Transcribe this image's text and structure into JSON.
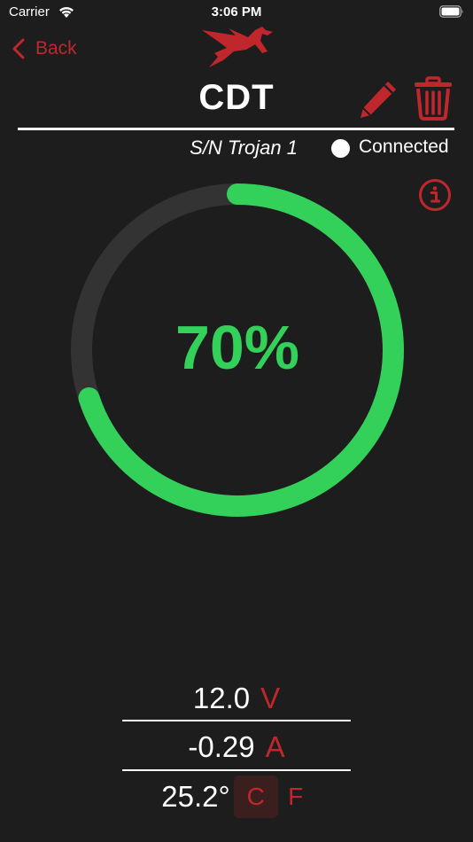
{
  "status_bar": {
    "carrier": "Carrier",
    "time": "3:06 PM"
  },
  "nav": {
    "back_label": "Back"
  },
  "device": {
    "name": "CDT",
    "serial": "S/N Trojan 1",
    "connection_status": "Connected"
  },
  "gauge": {
    "percent_label": "70%",
    "charge_fraction": 0.7,
    "fill_color": "#33d15a",
    "track_color": "#333333"
  },
  "readings": {
    "voltage": {
      "value": "12.0",
      "unit": "V"
    },
    "current": {
      "value": "-0.29",
      "unit": "A"
    },
    "temperature": {
      "value": "25.2°",
      "unit_c": "C",
      "unit_f": "F",
      "selected_unit": "C"
    }
  },
  "colors": {
    "accent": "#c0272d",
    "background": "#1d1d1d"
  },
  "icons": {
    "back": "chevron-left-icon",
    "edit": "pencil-icon",
    "delete": "trash-icon",
    "info": "info-icon",
    "logo": "pegasus-logo"
  }
}
